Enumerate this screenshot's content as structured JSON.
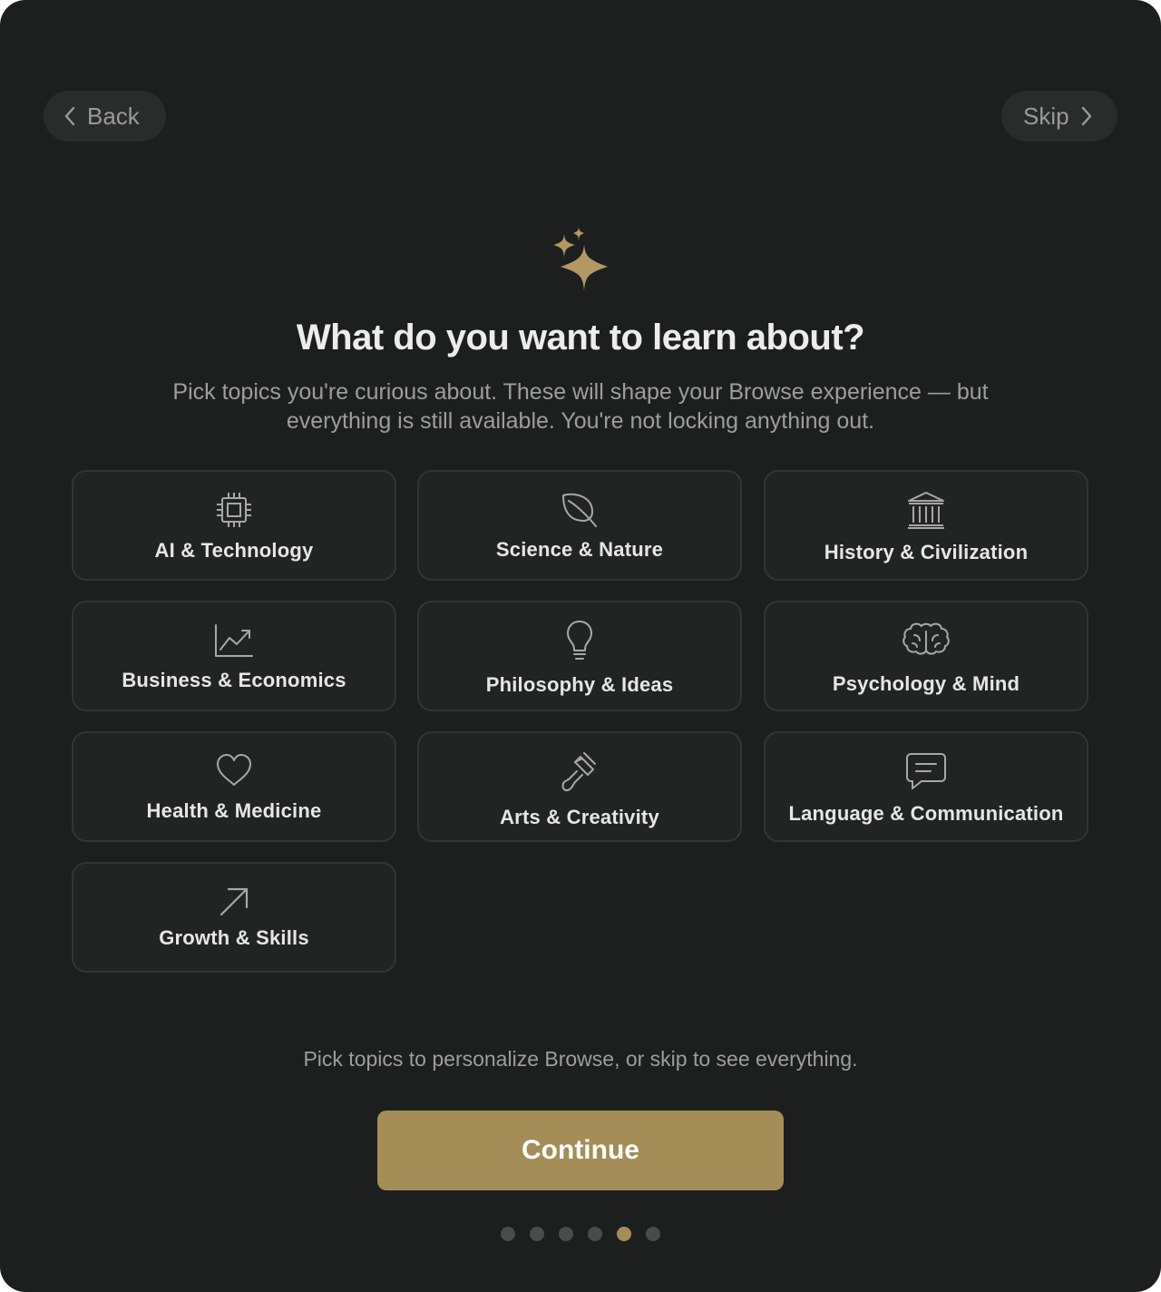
{
  "header": {
    "back_label": "Back",
    "skip_label": "Skip"
  },
  "hero": {
    "title": "What do you want to learn about?",
    "subtitle": "Pick topics you're curious about. These will shape your Browse experience — but everything is still available. You're not locking anything out."
  },
  "topics": [
    {
      "label": "AI & Technology",
      "icon": "chip-icon"
    },
    {
      "label": "Science & Nature",
      "icon": "leaf-icon"
    },
    {
      "label": "History & Civilization",
      "icon": "museum-icon"
    },
    {
      "label": "Business & Economics",
      "icon": "chart-trend-icon"
    },
    {
      "label": "Philosophy & Ideas",
      "icon": "lightbulb-icon"
    },
    {
      "label": "Psychology & Mind",
      "icon": "brain-icon"
    },
    {
      "label": "Health & Medicine",
      "icon": "heart-icon"
    },
    {
      "label": "Arts & Creativity",
      "icon": "paintbrush-icon"
    },
    {
      "label": "Language & Communication",
      "icon": "chat-icon"
    },
    {
      "label": "Growth & Skills",
      "icon": "arrow-up-right-icon"
    }
  ],
  "footer": {
    "hint": "Pick topics to personalize Browse, or skip to see everything.",
    "continue_label": "Continue"
  },
  "pagination": {
    "total": 6,
    "current": 5
  },
  "colors": {
    "background": "#1d1f1e",
    "card": "#222423",
    "accent": "#a48d57"
  }
}
